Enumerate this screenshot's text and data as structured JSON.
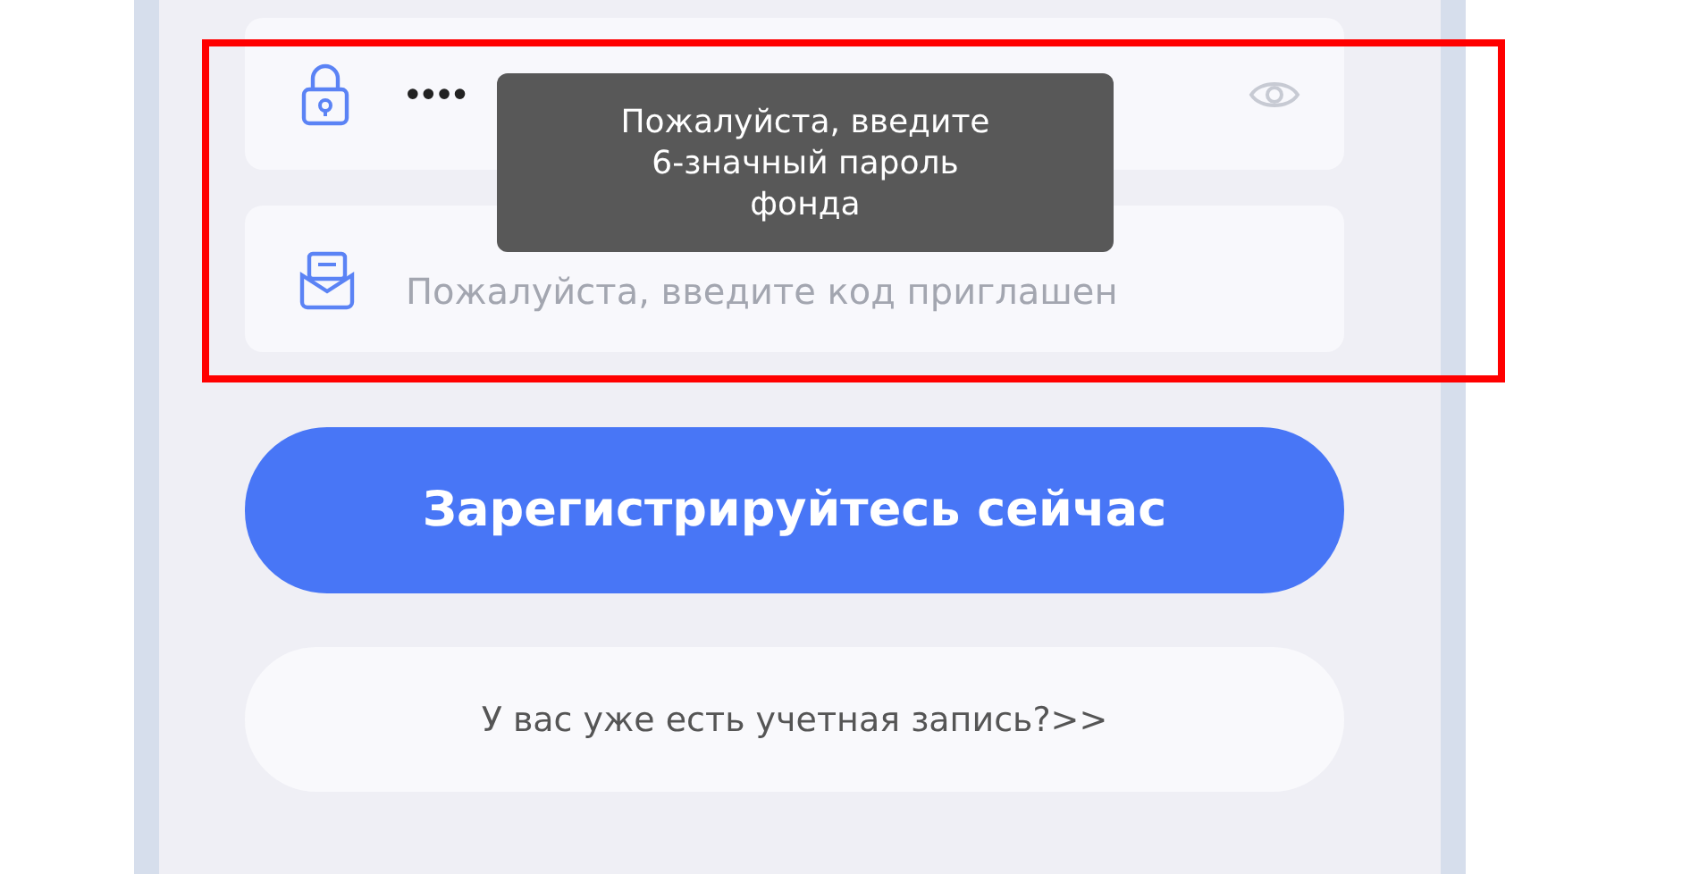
{
  "fields": {
    "highlighted": true,
    "password": {
      "value": "••••"
    },
    "tooltip": "Пожалуйста, введите 6-значный пароль фонда",
    "invite": {
      "placeholder": "Пожалуйста, введите код приглашен"
    }
  },
  "register_button": "Зарегистрируйтесь сейчас",
  "login_link": "У вас уже есть учетная запись?>>"
}
